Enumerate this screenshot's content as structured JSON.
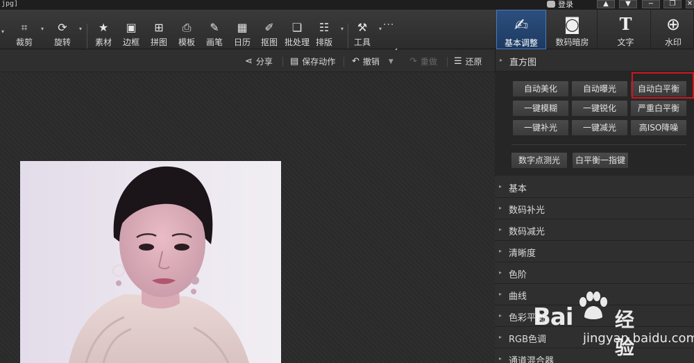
{
  "titlebar": {
    "filename": "jpg]",
    "login": "登录"
  },
  "window_controls": {
    "up": "▲",
    "down": "▼",
    "minimize": "−",
    "restore": "❐",
    "close": "✕"
  },
  "toolbar": {
    "items": [
      {
        "label": "裁剪",
        "icon": "crop-icon"
      },
      {
        "label": "旋转",
        "icon": "rotate-icon"
      },
      {
        "label": "素材",
        "icon": "sticker-icon"
      },
      {
        "label": "边框",
        "icon": "frame-icon"
      },
      {
        "label": "拼图",
        "icon": "collage-icon"
      },
      {
        "label": "模板",
        "icon": "template-icon"
      },
      {
        "label": "画笔",
        "icon": "brush-icon"
      },
      {
        "label": "日历",
        "icon": "calendar-icon"
      },
      {
        "label": "抠图",
        "icon": "cutout-icon"
      },
      {
        "label": "批处理",
        "icon": "batch-icon"
      },
      {
        "label": "排版",
        "icon": "layout-icon"
      },
      {
        "label": "工具",
        "icon": "wrench-icon"
      }
    ],
    "more": "···"
  },
  "right_tabs": [
    {
      "label": "基本调整",
      "icon": "edit-icon",
      "active": true
    },
    {
      "label": "数码暗房",
      "icon": "camera-icon",
      "active": false
    },
    {
      "label": "文字",
      "icon": "text-icon",
      "active": false
    },
    {
      "label": "水印",
      "icon": "watermark-icon",
      "active": false
    }
  ],
  "actions": {
    "share": "分享",
    "save_action": "保存动作",
    "undo": "撤销",
    "redo": "重做",
    "restore": "还原"
  },
  "panel": {
    "histogram": {
      "title": "直方图",
      "buttons": [
        "自动美化",
        "自动曝光",
        "自动白平衡",
        "一键模糊",
        "一键锐化",
        "严重白平衡",
        "一键补光",
        "一键减光",
        "高ISO降噪"
      ],
      "extra_buttons": [
        "数字点测光",
        "白平衡一指键"
      ]
    },
    "sections": [
      "基本",
      "数码补光",
      "数码减光",
      "清晰度",
      "色阶",
      "曲线",
      "色彩平衡",
      "RGB色调",
      "通道混合器"
    ]
  },
  "watermark": {
    "brand": "Bai",
    "brand2": "经验",
    "url": "jingyan.baidu.com"
  },
  "colors": {
    "highlight": "#d4141c",
    "active_tab": "#2d4f7d"
  }
}
